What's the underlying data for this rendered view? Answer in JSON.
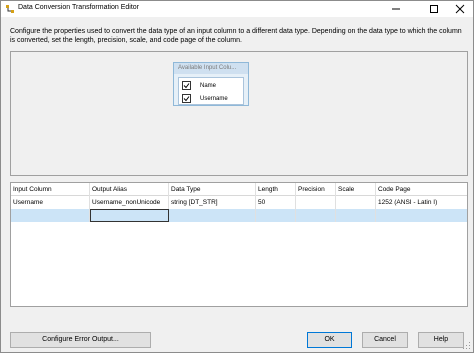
{
  "window": {
    "title": "Data Conversion Transformation Editor"
  },
  "description": "Configure the properties used to convert the data type of an input column to a different data type. Depending on the data type to which the column is converted, set the length, precision, scale, and code page of the column.",
  "available_columns": {
    "header": "Available Input Colu...",
    "items": [
      {
        "label": "Name",
        "checked": false
      },
      {
        "label": "Username",
        "checked": true
      }
    ]
  },
  "grid": {
    "columns": [
      "Input Column",
      "Output Alias",
      "Data Type",
      "Length",
      "Precision",
      "Scale",
      "Code Page"
    ],
    "rows": [
      [
        "Username",
        "Username_nonUnicode",
        "string [DT_STR]",
        "50",
        "",
        "",
        "1252  (ANSI - Latin I)"
      ],
      [
        "",
        "",
        "",
        "",
        "",
        "",
        ""
      ]
    ]
  },
  "buttons": {
    "configure_error_output": "Configure Error Output...",
    "ok": "OK",
    "cancel": "Cancel",
    "help": "Help"
  }
}
